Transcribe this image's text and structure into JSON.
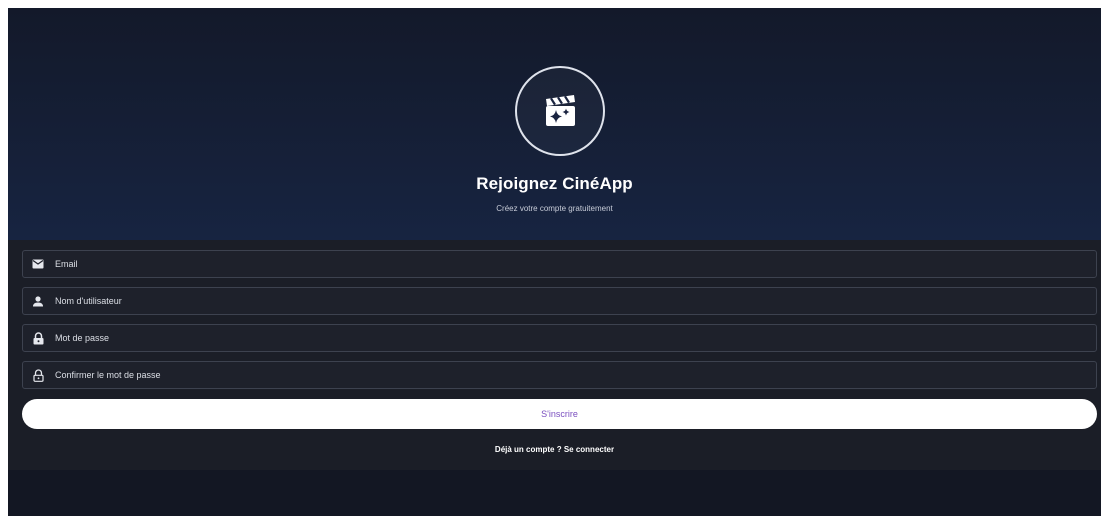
{
  "hero": {
    "logo_icon": "movie-clapper-sparkle-icon",
    "title": "Rejoignez CinéApp",
    "subtitle": "Créez votre compte gratuitement"
  },
  "form": {
    "fields": [
      {
        "icon": "mail-icon",
        "placeholder": "Email",
        "value": ""
      },
      {
        "icon": "person-icon",
        "placeholder": "Nom d'utilisateur",
        "value": ""
      },
      {
        "icon": "lock-icon",
        "placeholder": "Mot de passe",
        "value": ""
      },
      {
        "icon": "lock-outline-icon",
        "placeholder": "Confirmer le mot de passe",
        "value": ""
      }
    ],
    "submit_label": "S'inscrire",
    "login_link": "Déjà un compte ? Se connecter"
  },
  "colors": {
    "accent": "#7a4fbf",
    "background": "#161a24",
    "hero_top": "#13192a",
    "hero_bottom": "#172441"
  }
}
